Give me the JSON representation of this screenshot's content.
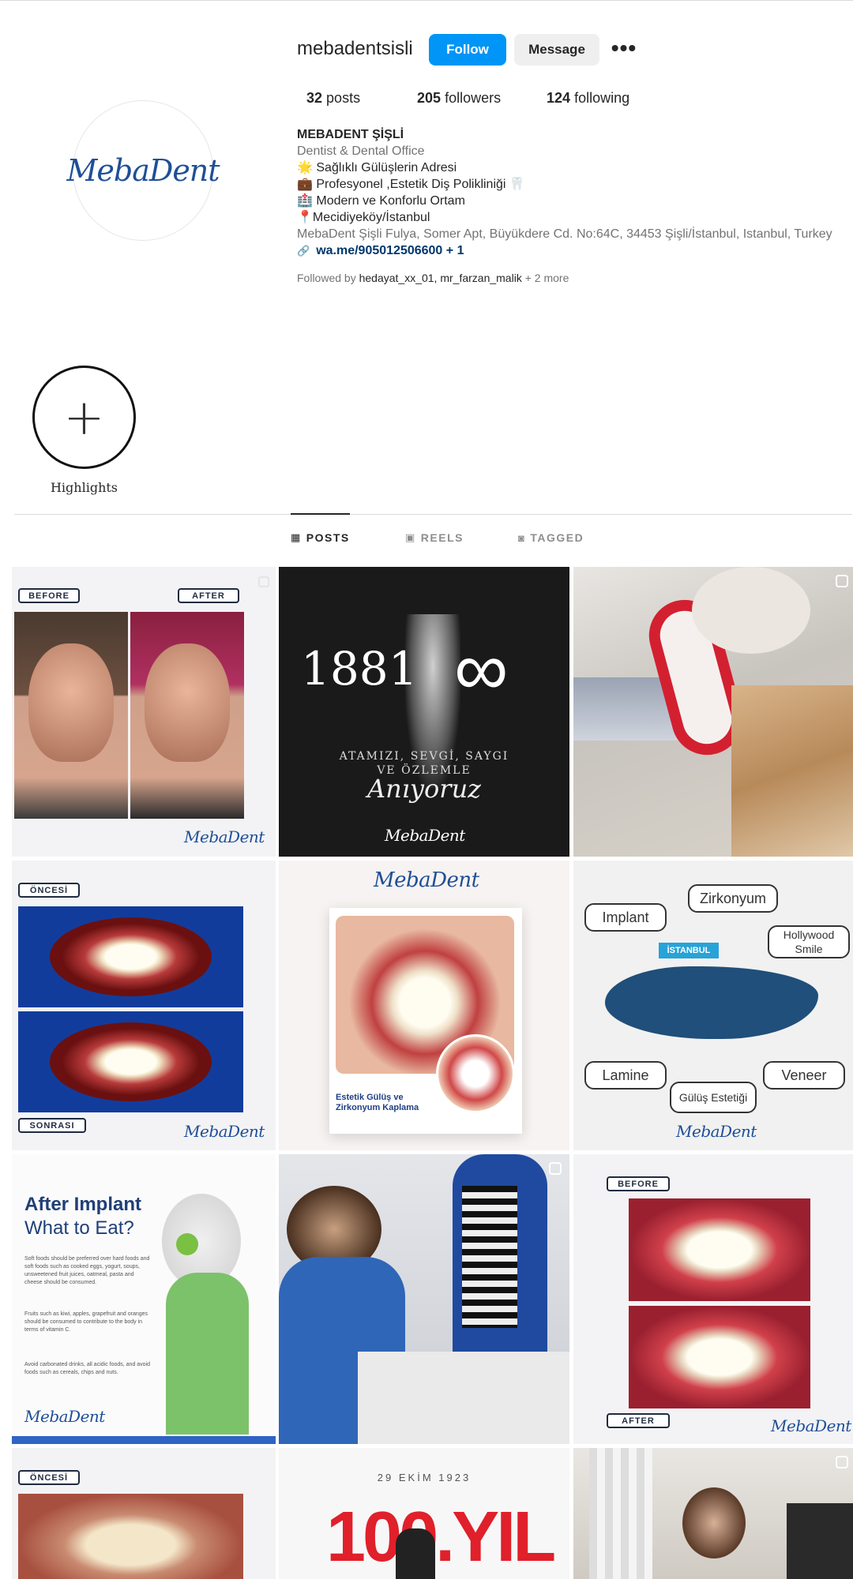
{
  "profile": {
    "username": "mebadentsisli",
    "follow_label": "Follow",
    "message_label": "Message",
    "more_label": "•••",
    "avatar_logo": "MebaDent",
    "posts_count": "32",
    "posts_label": "posts",
    "followers_count": "205",
    "followers_label": "followers",
    "following_count": "124",
    "following_label": "following"
  },
  "bio": {
    "name": "MEBADENT ŞİŞLİ",
    "category": "Dentist & Dental Office",
    "line1": "🌟 Sağlıklı Gülüşlerin Adresi",
    "line2": "💼 Profesyonel ,Estetik Diş Polikliniği 🦷",
    "line3": "🏥 Modern ve Konforlu Ortam",
    "line4": "📍Mecidiyeköy/İstanbul",
    "address": "MebaDent Şişli Fulya, Somer Apt, Büyükdere Cd. No:64C, 34453 Şişli/İstanbul, Istanbul, Turkey",
    "link": "wa.me/905012506600 + 1",
    "followed_prefix": "Followed by",
    "followed_users": "hedayat_xx_01, mr_farzan_malik",
    "followed_more": "+ 2 more"
  },
  "highlights": {
    "new_label": "Highlights"
  },
  "tabs": [
    {
      "label": "POSTS",
      "icon": "grid-icon",
      "active": true
    },
    {
      "label": "REELS",
      "icon": "reels-icon",
      "active": false
    },
    {
      "label": "TAGGED",
      "icon": "tagged-icon",
      "active": false
    }
  ],
  "posts": {
    "p1": {
      "before": "BEFORE",
      "after": "AFTER",
      "brand": "MebaDent"
    },
    "p2": {
      "year": "1881",
      "line1": "ATAMIZI, SEVGİ, SAYGI",
      "line2": "VE ÖZLEMLE",
      "script": "Anıyoruz",
      "brand": "MebaDent"
    },
    "p4": {
      "before": "ÖNCESİ",
      "after": "SONRASI",
      "brand": "MebaDent"
    },
    "p5": {
      "brand": "MebaDent",
      "caption": "Estetik Gülüş ve Zirkonyum Kaplama"
    },
    "p6": {
      "b1": "Implant",
      "b2": "Zirkonyum",
      "b3": "Hollywood Smile",
      "b4": "Lamine",
      "b5": "Gülüş Estetiği",
      "b6": "Veneer",
      "city": "İSTANBUL",
      "brand": "MebaDent"
    },
    "p7": {
      "title1": "After Implant",
      "title2": "What to Eat?",
      "t1": "Soft foods should be preferred over hard foods and soft foods such as cooked eggs, yogurt, soups, unsweetened fruit juices, oatmeal, pasta and cheese should be consumed.",
      "t2": "Fruits such as kiwi, apples, grapefruit and oranges should be consumed to contribute to the body in terms of vitamin C.",
      "t3": "Avoid carbonated drinks, all acidic foods, and avoid foods such as cereals, chips and nuts.",
      "brand": "MebaDent"
    },
    "p9": {
      "before": "BEFORE",
      "after": "AFTER",
      "brand": "MebaDent"
    },
    "p10": {
      "before": "ÖNCESİ"
    },
    "p11": {
      "date": "29 EKİM 1923",
      "big": "100.YIL"
    }
  },
  "colors": {
    "accent": "#0095f6",
    "brand_blue": "#1f4f96",
    "link": "#00376b"
  }
}
